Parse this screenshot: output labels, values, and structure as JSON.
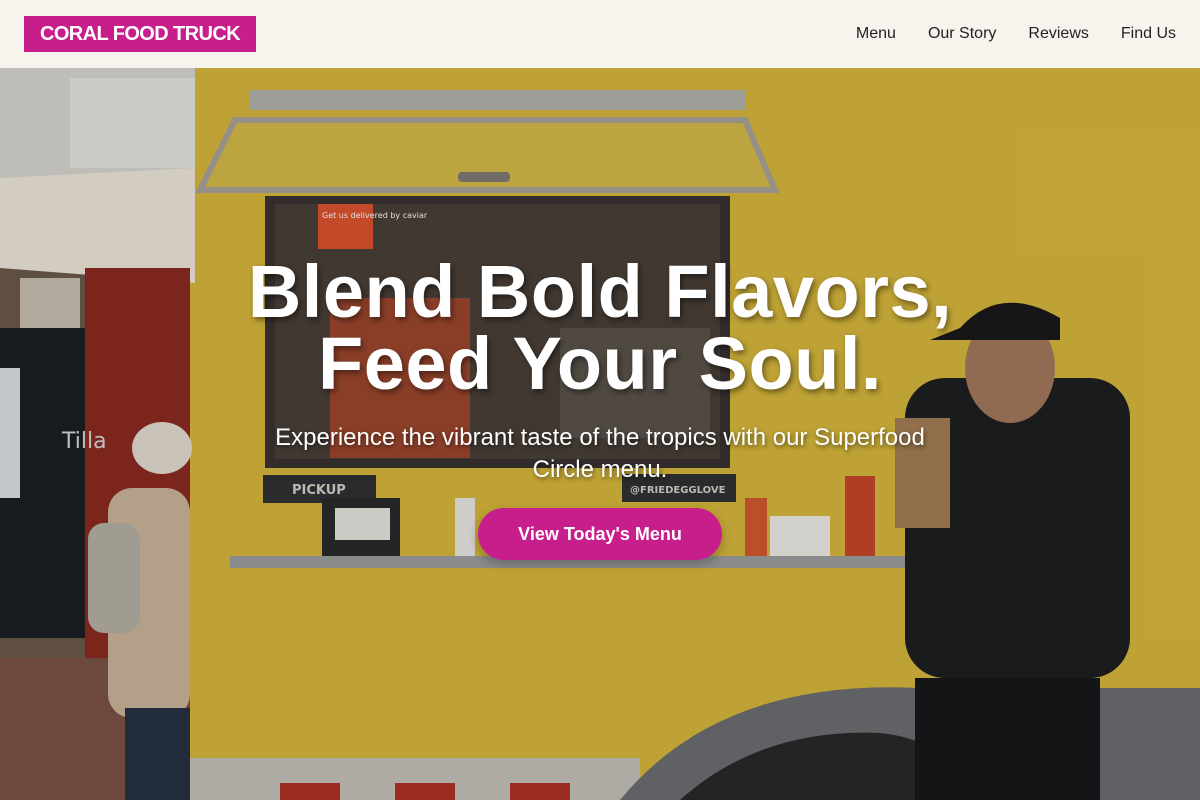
{
  "brand": {
    "name": "CORAL FOOD TRUCK"
  },
  "nav": {
    "items": [
      "Menu",
      "Our Story",
      "Reviews",
      "Find Us"
    ]
  },
  "hero": {
    "headline_line1": "Blend Bold Flavors,",
    "headline_line2": "Feed Your Soul.",
    "subtext": "Experience the vibrant taste of the tropics with our Superfood Circle menu.",
    "cta_label": "View Today's Menu"
  },
  "photo": {
    "window_sign": "Get us delivered by caviar",
    "pickup_sign": "PICKUP",
    "handle_sign": "@FRIEDEGGLOVE",
    "shop_sign": "Tilla"
  },
  "colors": {
    "accent": "#c81e8c",
    "nav_bg": "#f7f4ee",
    "truck_yellow": "#d8b737"
  }
}
